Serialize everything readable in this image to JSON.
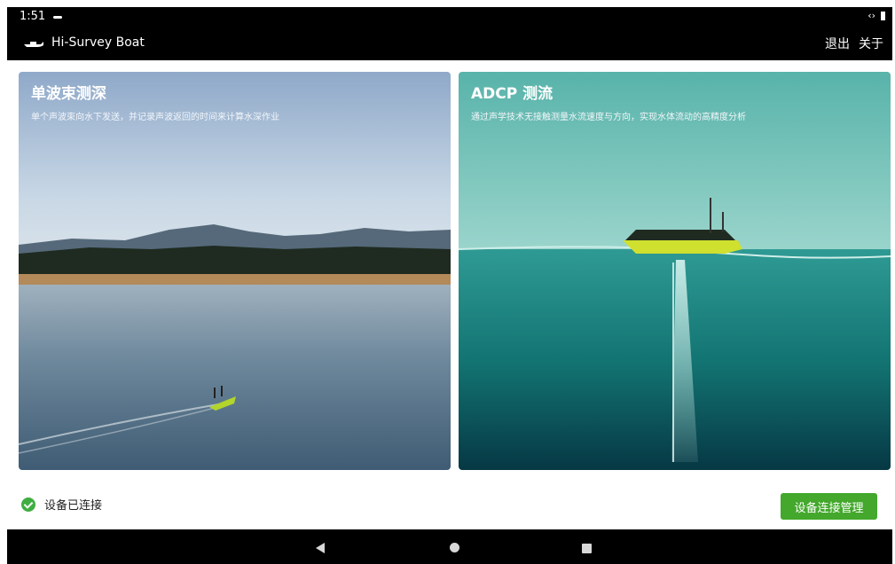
{
  "status_bar": {
    "time": "1:51"
  },
  "app_bar": {
    "title": "Hi-Survey Boat",
    "actions": {
      "exit": "退出",
      "about": "关于"
    }
  },
  "cards": [
    {
      "title": "单波束测深",
      "description": "单个声波束向水下发送，并记录声波返回的时间来计算水深作业"
    },
    {
      "title": "ADCP 测流",
      "description": "通过声学技术无接触测量水流速度与方向，实现水体流动的高精度分析"
    }
  ],
  "footer": {
    "connection_status": "设备已连接",
    "manage_button": "设备连接管理"
  },
  "icons": {
    "boat": "boat-icon",
    "check": "check-circle-icon",
    "nav_back": "back-icon",
    "nav_home": "home-icon",
    "nav_recent": "recent-apps-icon"
  },
  "colors": {
    "accent_green": "#43a82c",
    "status_ok": "#3fae41",
    "bar_black": "#000000"
  }
}
